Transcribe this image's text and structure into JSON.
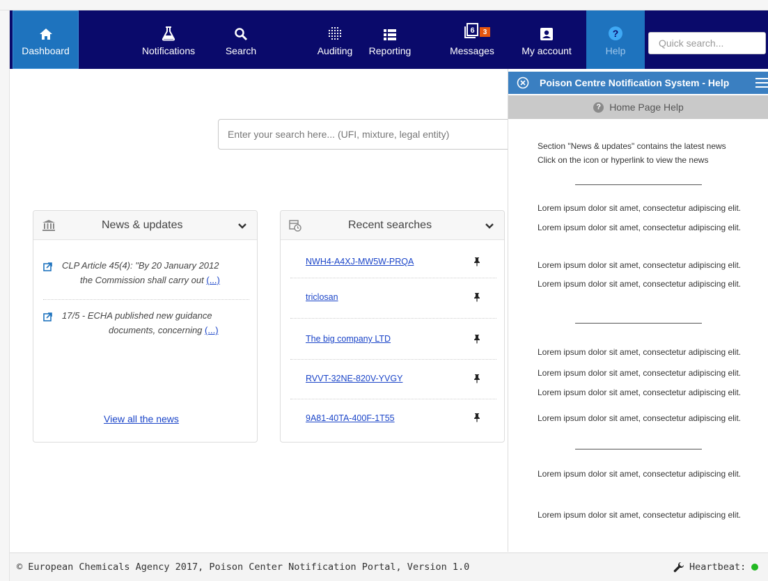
{
  "nav": {
    "items": [
      {
        "label": "Dashboard"
      },
      {
        "label": "Notifications"
      },
      {
        "label": "Search"
      },
      {
        "label": "Auditing"
      },
      {
        "label": "Reporting"
      },
      {
        "label": "Messages",
        "badge": "3",
        "icon_count": "6"
      },
      {
        "label": "My account"
      },
      {
        "label": "Help"
      }
    ],
    "quick_search_placeholder": "Quick search..."
  },
  "search": {
    "placeholder": "Enter your search here... (UFI, mixture, legal entity)"
  },
  "news": {
    "title": "News & updates",
    "items": [
      {
        "line1": "CLP Article 45(4): \"By 20 January 2012",
        "line2": "the Commission shall carry out",
        "more": "(...)"
      },
      {
        "line1": "17/5 - ECHA published new guidance",
        "line2": "documents, concerning",
        "more": "(...)"
      }
    ],
    "view_all": "View all the news"
  },
  "recent": {
    "title": "Recent searches",
    "items": [
      {
        "label": "NWH4-A4XJ-MW5W-PRQA"
      },
      {
        "label": "triclosan"
      },
      {
        "label": "The big company LTD"
      },
      {
        "label": "RVVT-32NE-820V-YVGY"
      },
      {
        "label": "9A81-40TA-400F-1T55"
      }
    ]
  },
  "help": {
    "title": "Poison Centre Notification System - Help",
    "subtitle": "Home Page Help",
    "intro": [
      "Section \"News & updates\" contains the latest news",
      "Click on the icon or hyperlink to view the news"
    ],
    "lorem": "Lorem ipsum dolor sit amet, consectetur adipiscing elit."
  },
  "footer": {
    "copyright": "© European Chemicals Agency 2017, Poison Center Notification Portal, Version 1.0",
    "heartbeat": "Heartbeat:"
  },
  "colors": {
    "nav_bg": "#0a0a6b",
    "active_tab": "#1e73be",
    "badge": "#e8560e",
    "help_header": "#3a7fc1",
    "link": "#1a44c8",
    "heartbeat_ok": "#22b822"
  }
}
